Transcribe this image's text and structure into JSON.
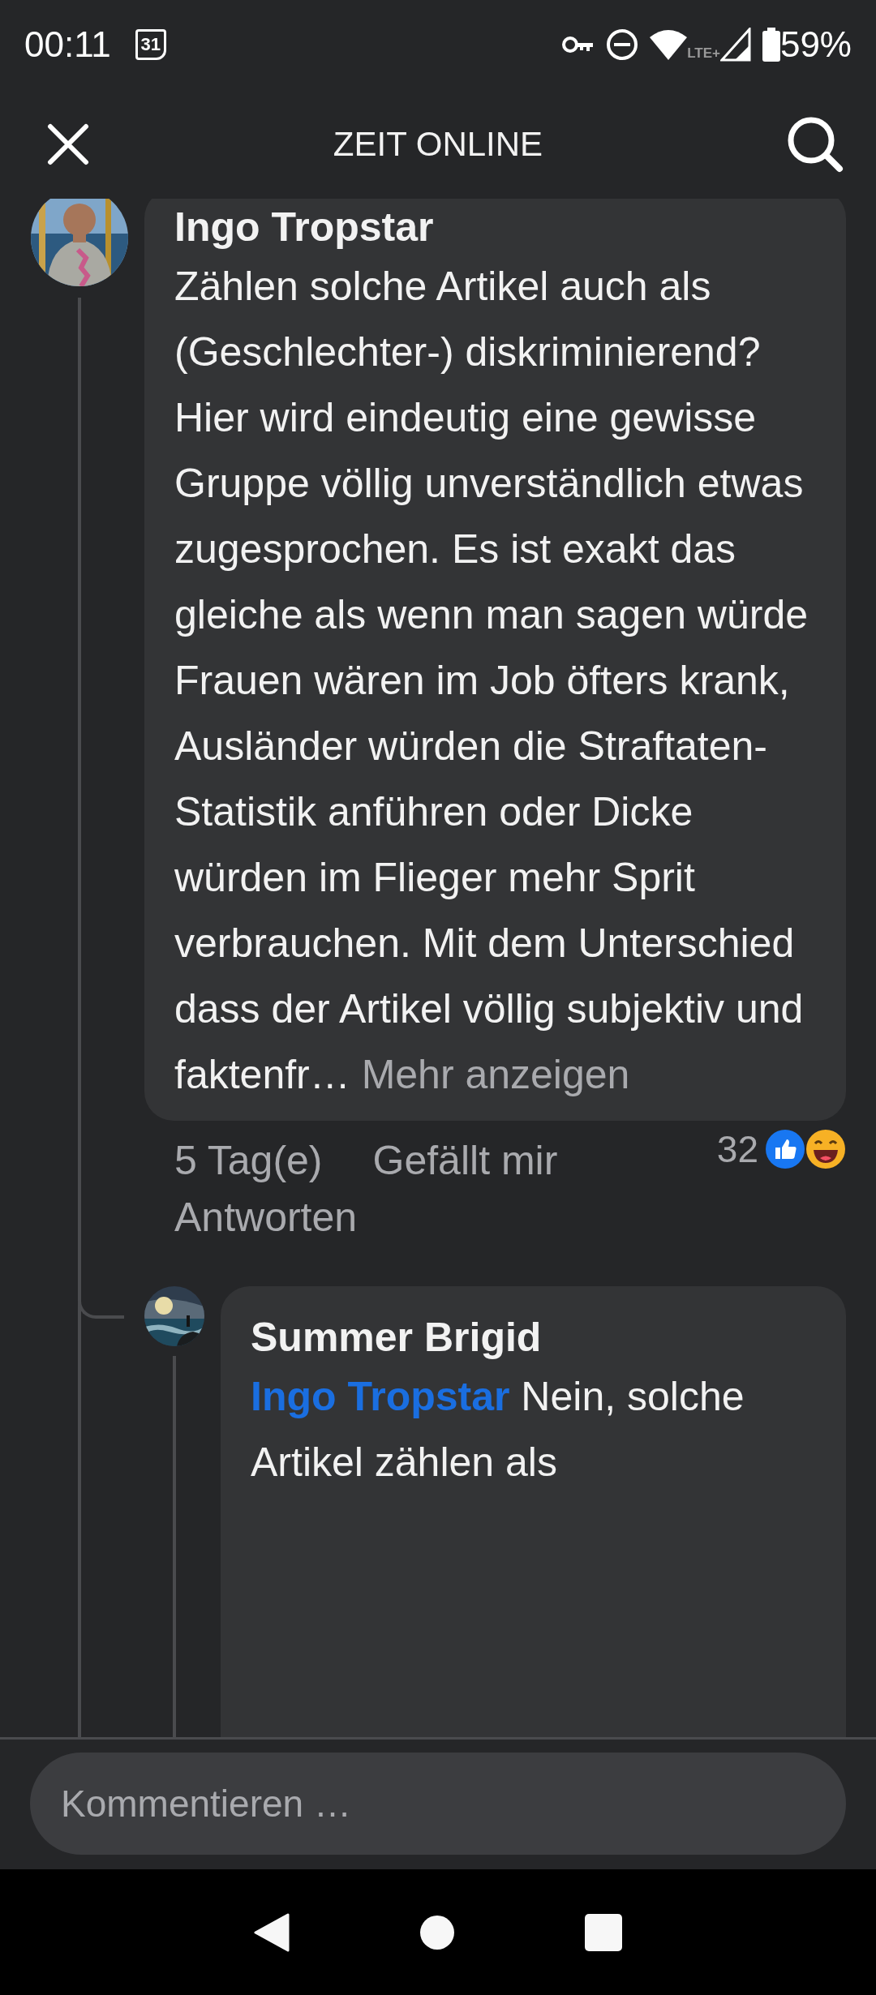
{
  "status_bar": {
    "time": "00:11",
    "calendar_day": "31",
    "network_type": "LTE+",
    "battery": "59%"
  },
  "header": {
    "title": "ZEIT ONLINE"
  },
  "comments": [
    {
      "author": "Ingo Tropstar",
      "text": "Zählen solche Artikel auch als (Geschlechter-) diskriminierend? Hier wird eindeutig eine gewisse Gruppe völlig unverständlich etwas zugesprochen. Es ist exakt das gleiche als wenn man sagen würde Frauen wären im Job öfters krank, Ausländer würden die Straftaten-Statistik anführen oder Dicke würden im Flieger mehr Sprit verbrauchen. Mit dem Unterschied dass der Artikel völlig subjektiv und faktenfr…",
      "more_link": "Mehr anzeigen",
      "age": "5 Tag(e)",
      "like_action": "Gefällt mir",
      "reply_action": "Antworten",
      "reaction_count": "32",
      "reactions": [
        {
          "kind": "like"
        },
        {
          "kind": "haha"
        }
      ],
      "replies": [
        {
          "author": "Summer Brigid",
          "mention": "Ingo Tropstar",
          "text": "Nein, solche Artikel zählen als"
        }
      ]
    }
  ],
  "composer": {
    "placeholder": "Kommentieren …"
  }
}
